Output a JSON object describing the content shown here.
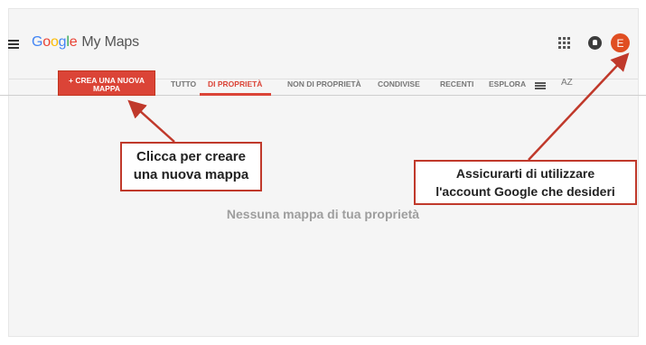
{
  "header": {
    "logo_google": [
      "G",
      "o",
      "o",
      "g",
      "l",
      "e"
    ],
    "product_name": "My Maps",
    "avatar_initial": "E"
  },
  "toolbar": {
    "create_button_label": "+ CREA UNA NUOVA MAPPA",
    "tabs": [
      {
        "label": "TUTTO",
        "active": false
      },
      {
        "label": "DI PROPRIETÀ",
        "active": true
      },
      {
        "label": "NON DI PROPRIETÀ",
        "active": false
      },
      {
        "label": "CONDIVISE",
        "active": false
      },
      {
        "label": "RECENTI",
        "active": false
      },
      {
        "label": "ESPLORA",
        "active": false
      }
    ],
    "sort_label": "AZ"
  },
  "main": {
    "empty_message": "Nessuna mappa di tua proprietà"
  },
  "annotations": {
    "callout_create": [
      "Clicca per creare",
      "una nuova mappa"
    ],
    "callout_account": [
      "Assicurarti di utilizzare",
      "l'account Google che desideri"
    ]
  },
  "colors": {
    "accent": "#db4437",
    "annotation": "#c0392b",
    "avatar": "#e04e22"
  },
  "icons": {
    "menu": "hamburger-menu-icon",
    "apps": "apps-grid-icon",
    "notifications": "notifications-icon",
    "list_view": "list-view-icon",
    "sort": "sort-az-icon"
  }
}
